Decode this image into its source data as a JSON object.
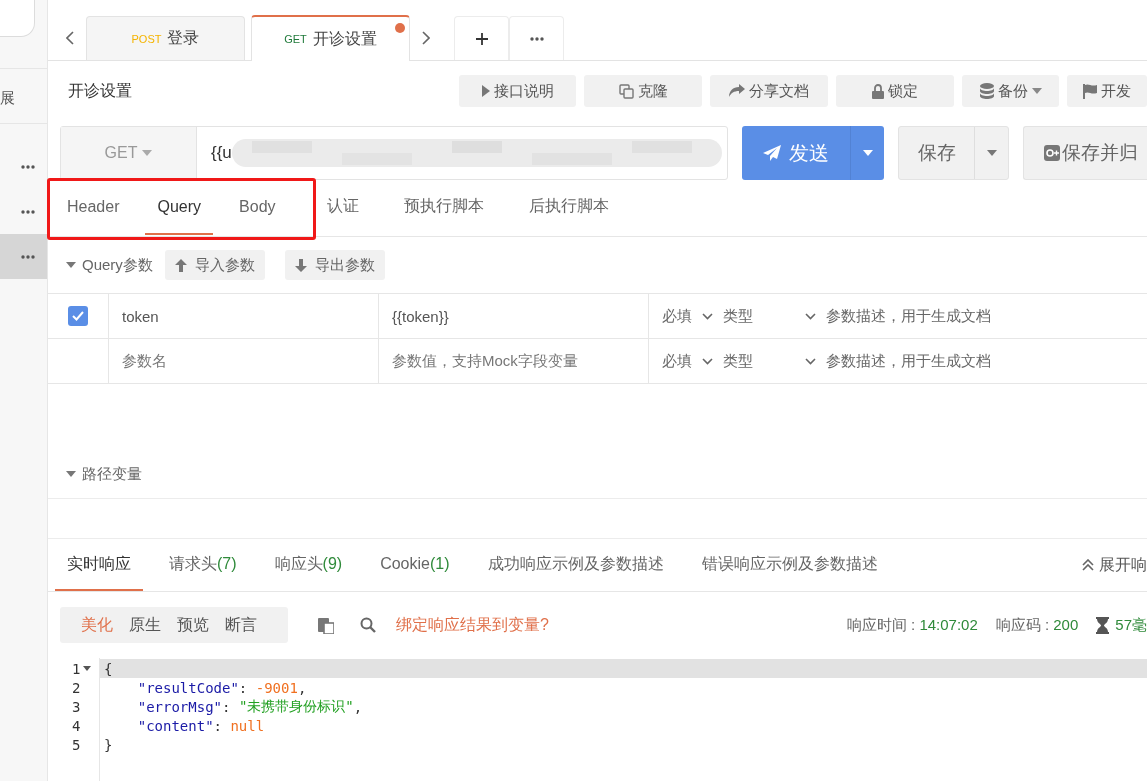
{
  "sidebar": {
    "partial_label": "展",
    "items": [
      {
        "selected": false
      },
      {
        "selected": false
      },
      {
        "selected": true
      }
    ]
  },
  "tabs": [
    {
      "method": "POST",
      "color": "#f5b400",
      "title": "登录",
      "selected": false,
      "modified": false
    },
    {
      "method": "GET",
      "color": "#1f7a3a",
      "title": "开诊设置",
      "selected": true,
      "modified": true
    }
  ],
  "page_title": "开诊设置",
  "toolbar": [
    {
      "label": "接口说明",
      "kind": "plain"
    },
    {
      "label": "克隆",
      "kind": "plain"
    },
    {
      "label": "分享文档",
      "kind": "plain"
    },
    {
      "label": "锁定",
      "kind": "plain"
    },
    {
      "label": "备份",
      "kind": "dropdown"
    },
    {
      "label": "开发",
      "kind": "plain"
    }
  ],
  "request": {
    "method": "GET",
    "url": "{{u",
    "send": "发送",
    "save": "保存",
    "save_archive": "保存并归"
  },
  "request_tabs": [
    {
      "label": "Header",
      "selected": false,
      "highlighted": true
    },
    {
      "label": "Query",
      "selected": true,
      "highlighted": true
    },
    {
      "label": "Body",
      "selected": false,
      "highlighted": true
    },
    {
      "label": "认证",
      "selected": false,
      "highlighted": false
    },
    {
      "label": "预执行脚本",
      "selected": false,
      "highlighted": false
    },
    {
      "label": "后执行脚本",
      "selected": false,
      "highlighted": false
    }
  ],
  "query": {
    "title": "Query参数",
    "expanded": true,
    "buttons": [
      "导入参数",
      "导出参数"
    ],
    "rows": [
      {
        "kind": "param",
        "checked": true,
        "name": "token",
        "value": "{{token}}",
        "required": "必填",
        "type": "类型",
        "description": "参数描述，用于生成文档"
      },
      {
        "kind": "new",
        "name_placeholder": "参数名",
        "value_placeholder": "参数值，支持Mock字段变量",
        "required": "必填",
        "type": "类型",
        "description": "参数描述，用于生成文档"
      }
    ]
  },
  "path_vars": {
    "title": "路径变量",
    "expanded": true
  },
  "response_tabs": [
    {
      "label": "实时响应",
      "selected": true
    },
    {
      "label": "请求头",
      "count": "(7)",
      "selected": false
    },
    {
      "label": "响应头",
      "count": "(9)",
      "selected": false
    },
    {
      "label": "Cookie",
      "count": "(1)",
      "selected": false
    },
    {
      "label": "成功响应示例及参数描述",
      "selected": false
    },
    {
      "label": "错误响应示例及参数描述",
      "selected": false
    }
  ],
  "expand_response": "展开响",
  "view_modes": [
    {
      "label": "美化",
      "selected": true
    },
    {
      "label": "原生",
      "selected": false
    },
    {
      "label": "预览",
      "selected": false
    },
    {
      "label": "断言",
      "selected": false
    }
  ],
  "bind_link": "绑定响应结果到变量?",
  "stats": [
    {
      "label": "响应时间 : ",
      "value": "14:07:02"
    },
    {
      "label": "响应码 : ",
      "value": "200"
    }
  ],
  "duration": "57毫",
  "code": [
    {
      "num": "1",
      "foldable": true,
      "current": true,
      "tokens": [
        {
          "kind": "punct",
          "text": "{"
        }
      ]
    },
    {
      "num": "2",
      "foldable": false,
      "current": false,
      "tokens": [
        {
          "kind": "key",
          "text": "    \"resultCode\""
        },
        {
          "kind": "punct",
          "text": ": "
        },
        {
          "kind": "number",
          "text": "-9001"
        },
        {
          "kind": "punct",
          "text": ","
        }
      ]
    },
    {
      "num": "3",
      "foldable": false,
      "current": false,
      "tokens": [
        {
          "kind": "key",
          "text": "    \"errorMsg\""
        },
        {
          "kind": "punct",
          "text": ": "
        },
        {
          "kind": "string",
          "text": "\"未携带身份标识\""
        },
        {
          "kind": "punct",
          "text": ","
        }
      ]
    },
    {
      "num": "4",
      "foldable": false,
      "current": false,
      "tokens": [
        {
          "kind": "key",
          "text": "    \"content\""
        },
        {
          "kind": "punct",
          "text": ": "
        },
        {
          "kind": "null",
          "text": "null"
        }
      ]
    },
    {
      "num": "5",
      "foldable": false,
      "current": false,
      "tokens": [
        {
          "kind": "punct",
          "text": "}"
        }
      ]
    }
  ]
}
